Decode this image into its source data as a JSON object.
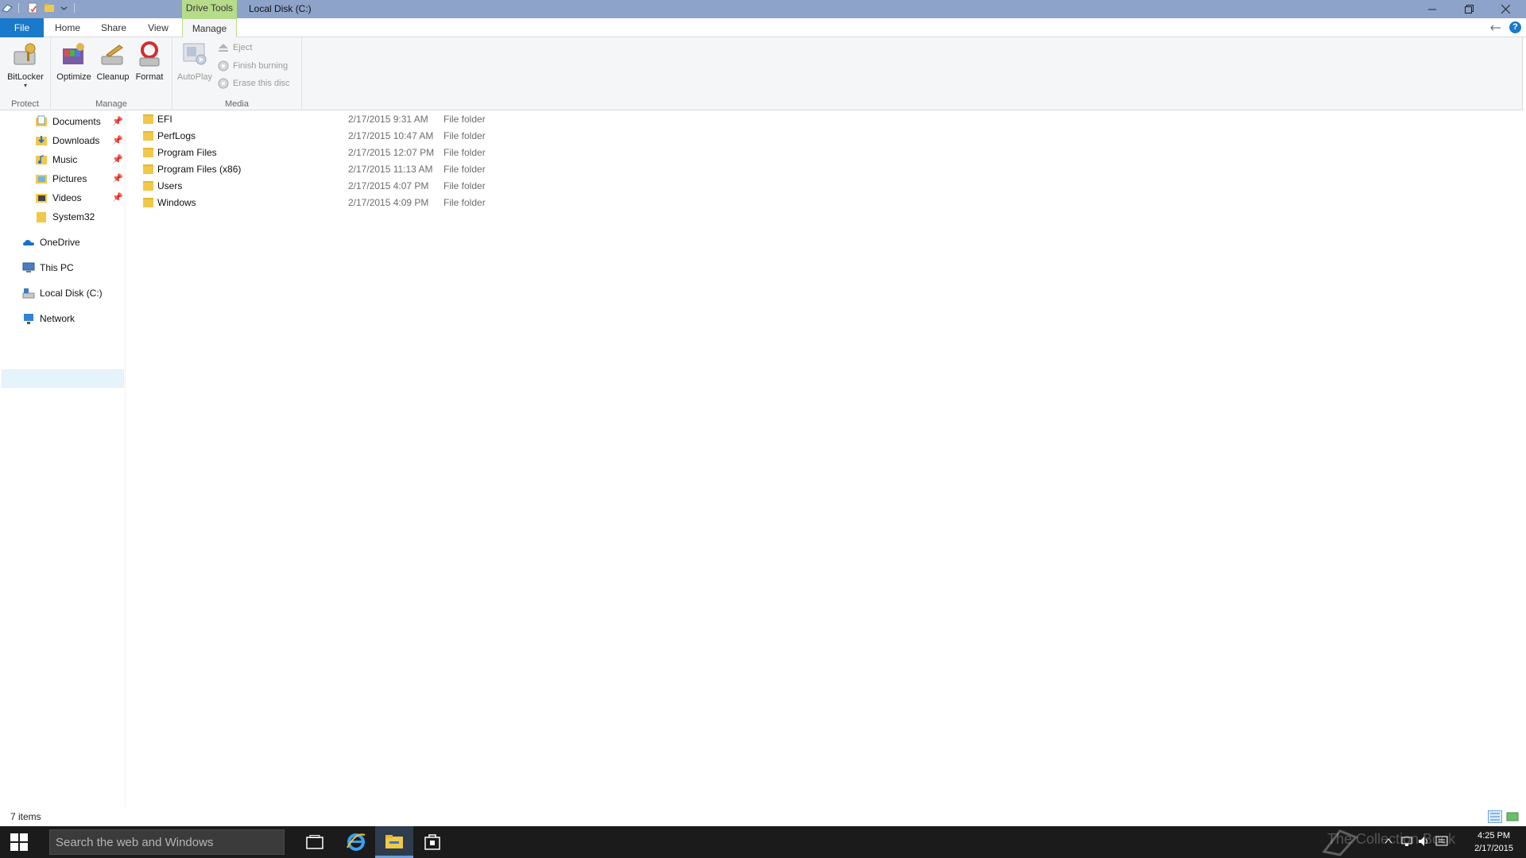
{
  "titlebar": {
    "contextual_tab": "Drive Tools",
    "window_title": "Local Disk (C:)"
  },
  "tabs": {
    "file": "File",
    "home": "Home",
    "share": "Share",
    "view": "View",
    "manage": "Manage"
  },
  "ribbon": {
    "bitlocker": "BitLocker",
    "optimize": "Optimize",
    "cleanup": "Cleanup",
    "format": "Format",
    "autoplay": "AutoPlay",
    "eject": "Eject",
    "finish_burning": "Finish burning",
    "erase_disc": "Erase this disc",
    "group_protect": "Protect",
    "group_manage": "Manage",
    "group_media": "Media"
  },
  "nav": {
    "quick": [
      "Documents",
      "Downloads",
      "Music",
      "Pictures",
      "Videos",
      "System32"
    ],
    "onedrive": "OneDrive",
    "thispc": "This PC",
    "localdisk": "Local Disk (C:)",
    "network": "Network"
  },
  "files": [
    {
      "name": "EFI",
      "date": "2/17/2015 9:31 AM",
      "type": "File folder"
    },
    {
      "name": "PerfLogs",
      "date": "2/17/2015 10:47 AM",
      "type": "File folder"
    },
    {
      "name": "Program Files",
      "date": "2/17/2015 12:07 PM",
      "type": "File folder"
    },
    {
      "name": "Program Files (x86)",
      "date": "2/17/2015 11:13 AM",
      "type": "File folder"
    },
    {
      "name": "Users",
      "date": "2/17/2015 4:07 PM",
      "type": "File folder"
    },
    {
      "name": "Windows",
      "date": "2/17/2015 4:09 PM",
      "type": "File folder"
    }
  ],
  "status": {
    "count": "7 items"
  },
  "taskbar": {
    "search_placeholder": "Search the web and Windows",
    "watermark": "The Collection Book",
    "time": "4:25 PM",
    "date": "2/17/2015"
  }
}
